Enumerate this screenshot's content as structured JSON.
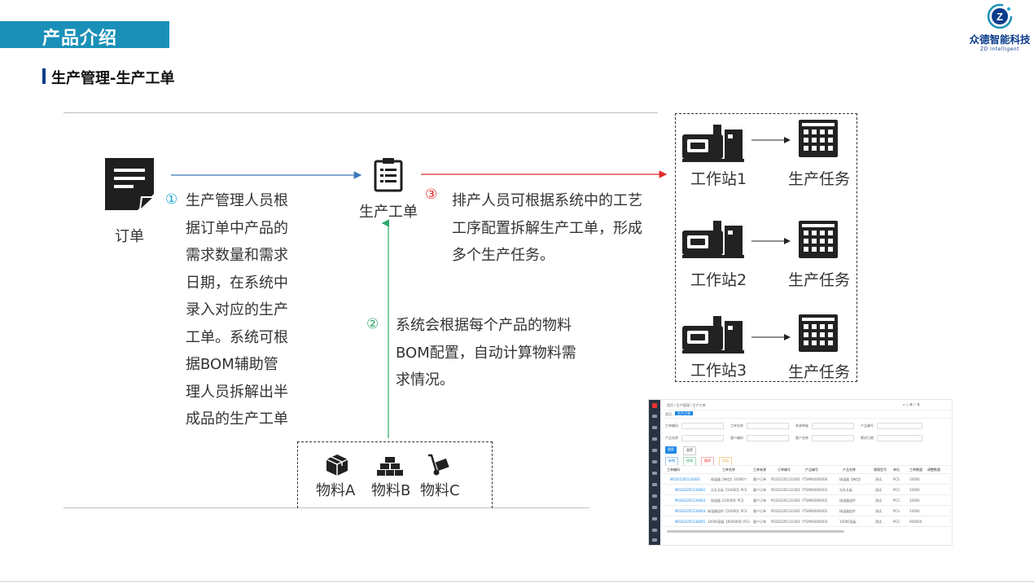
{
  "header": {
    "banner_title": "产品介绍",
    "brand_name": "众德智能科技",
    "brand_sub": "ZD Intelligent",
    "brand_mark": "Z"
  },
  "section_title": "生产管理-生产工单",
  "diagram": {
    "order_label": "订单",
    "work_order_label": "生产工单",
    "step1": {
      "number": "①",
      "lines": [
        "生产管理人员根",
        "据订单中产品的",
        "需求数量和需求",
        "日期，在系统中",
        "录入对应的生产",
        "工单。系统可根",
        "据BOM辅助管",
        "理人员拆解出半",
        "成品的生产工单"
      ]
    },
    "step2": {
      "number": "②",
      "lines": [
        "系统会根据每个产品的物料",
        "BOM配置，自动计算物料需",
        "求情况。"
      ]
    },
    "step3": {
      "number": "③",
      "lines": [
        "排产人员可根据系统中的工艺",
        "工序配置拆解生产工单，形成",
        "多个生产任务。"
      ]
    },
    "stations": [
      {
        "name": "工作站1",
        "task": "生产任务"
      },
      {
        "name": "工作站2",
        "task": "生产任务"
      },
      {
        "name": "工作站3",
        "task": "生产任务"
      }
    ],
    "materials": [
      "物料A",
      "物料B",
      "物料C"
    ]
  },
  "screenshot": {
    "breadcrumb": "首页 / 生产管理 / 生产工单",
    "tabs": [
      "首页",
      "生产工单"
    ],
    "filters": [
      "工单编码",
      "工单名称",
      "来源单据",
      "产品编号",
      "产品名称",
      "客户编码",
      "客户名称",
      "需求日期"
    ],
    "buttons": [
      "搜索",
      "重置",
      "新增",
      "修改",
      "删除",
      "导出"
    ],
    "columns": [
      "工单编码",
      "工单名称",
      "工单来源",
      "订单编号",
      "产品编号",
      "产品名称",
      "规格型号",
      "单位",
      "工单数量",
      "调整数量"
    ],
    "rows": [
      [
        "MO202205130001",
        "绿温器【带包】10000个",
        "客户订单",
        "PO202205131001",
        "YTSM00000006",
        "绿温器【带包】",
        "测试",
        "PCS",
        "10000"
      ],
      [
        "MO202205130002",
        "光孔孔板【10000】PCS",
        "客户订单",
        "PO202205131001",
        "YTSM00000003",
        "光孔孔板",
        "测试",
        "PCS",
        "10000"
      ],
      [
        "MO202205130003",
        "绿温器【10000】PCS",
        "客户订单",
        "PO202205131001",
        "YTSM00000002",
        "绿温器组件",
        "测试",
        "PCS",
        "10000"
      ],
      [
        "MO202205130004",
        "绿温器组件【10000】PCS",
        "客户订单",
        "PO202205131001",
        "YTSM00000002",
        "绿温器组件",
        "测试",
        "PCS",
        "10000"
      ],
      [
        "MO202205130005",
        "10000面板【900000】PCS",
        "客户订单",
        "PO202205131001",
        "YTSM00000004",
        "10000面板",
        "测试",
        "PCS",
        "900000"
      ]
    ]
  },
  "colors": {
    "banner": "#1a90b8",
    "brand": "#0b3c8c",
    "arrow_blue": "#3a78b8",
    "arrow_red": "#e32b2b",
    "arrow_green": "#2ea86a",
    "step1": "#1aa7d6",
    "step2": "#2ea86a",
    "step3": "#e32b2b"
  }
}
